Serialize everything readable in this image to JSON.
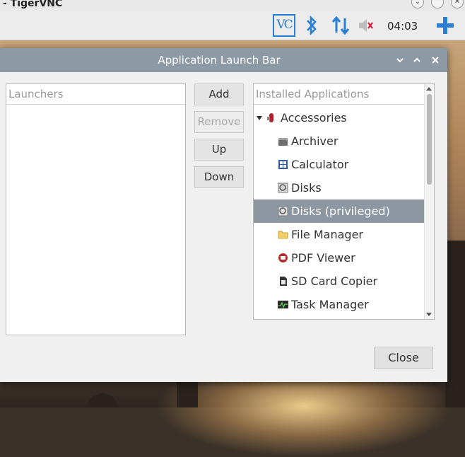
{
  "vnc_window": {
    "title": "- TigerVNC",
    "controls": [
      "chevron-down",
      "chevron-up",
      "close"
    ]
  },
  "panel": {
    "tray_vnc_label": "VC",
    "icons": [
      "vnc-icon",
      "bluetooth-icon",
      "network-arrows-icon",
      "volume-muted-icon",
      "add-icon"
    ],
    "clock": "04:03"
  },
  "dialog": {
    "title": "Application Launch Bar",
    "launchers": {
      "header": "Launchers",
      "items": []
    },
    "buttons": {
      "add": "Add",
      "remove": "Remove",
      "up": "Up",
      "down": "Down",
      "close": "Close"
    },
    "installed": {
      "header": "Installed Applications",
      "category": "Accessories",
      "items": [
        {
          "label": "Archiver",
          "icon": "archiver-icon"
        },
        {
          "label": "Calculator",
          "icon": "calculator-icon"
        },
        {
          "label": "Disks",
          "icon": "disks-icon"
        },
        {
          "label": "Disks (privileged)",
          "icon": "disks-icon",
          "selected": true
        },
        {
          "label": "File Manager",
          "icon": "folder-icon"
        },
        {
          "label": "PDF Viewer",
          "icon": "pdf-icon"
        },
        {
          "label": "SD Card Copier",
          "icon": "sd-card-icon"
        },
        {
          "label": "Task Manager",
          "icon": "task-manager-icon"
        }
      ]
    }
  },
  "colors": {
    "dialog_titlebar": "#8d9aa6",
    "selected_row": "#8d97a1",
    "tray_blue": "#2a7fd4"
  }
}
